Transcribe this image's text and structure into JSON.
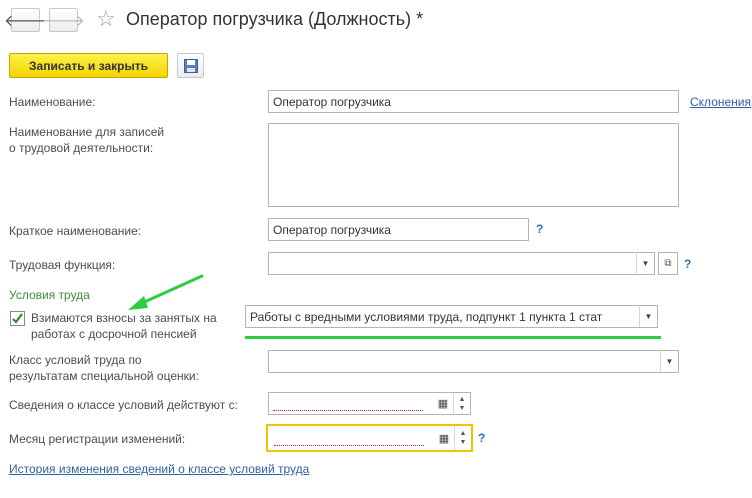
{
  "nav": {
    "back_icon": "arrow-left-icon",
    "forward_icon": "arrow-right-icon",
    "back_glyph": "🡐",
    "forward_glyph": "🡒"
  },
  "header": {
    "star_glyph": "☆",
    "title": "Оператор погрузчика (Должность) *"
  },
  "toolbar": {
    "save_close_label": "Записать и закрыть",
    "save_icon": "floppy-disk-icon"
  },
  "form": {
    "name_label": "Наименование:",
    "name_value": "Оператор погрузчика",
    "declension_link": "Склонения",
    "work_record_label_1": "Наименование для записей",
    "work_record_label_2": "о трудовой деятельности:",
    "work_record_value": "",
    "short_name_label": "Краткое наименование:",
    "short_name_value": "Оператор погрузчика",
    "help_glyph": "?",
    "labor_function_label": "Трудовая функция:",
    "labor_function_value": "",
    "conditions_section": "Условия труда",
    "contrib_label_1": "Взимаются взносы за занятых на",
    "contrib_label_2": "работах с досрочной пенсией",
    "contrib_checked": true,
    "contrib_value": "Работы с вредными условиями труда, подпункт 1 пункта 1 стат",
    "class_label_1": "Класс условий труда по",
    "class_label_2": "результатам специальной оценки:",
    "class_value": "",
    "class_valid_label": "Сведения о классе условий действуют с:",
    "class_valid_value": "",
    "reg_month_label": "Месяц регистрации изменений:",
    "reg_month_value": "",
    "history_link": "История изменения сведений о классе условий труда"
  },
  "colors": {
    "accent_yellow": "#f5d800",
    "annotation_green": "#2ecc40",
    "link_blue": "#2f5fa5",
    "section_green": "#3c8f3c"
  }
}
